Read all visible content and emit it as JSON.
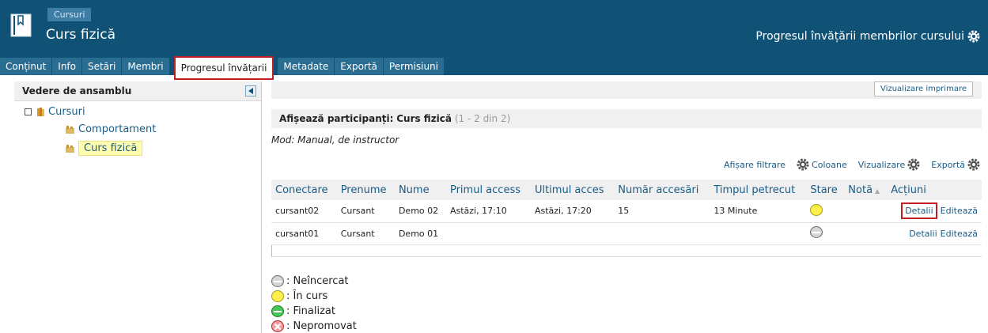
{
  "header": {
    "crumb": "Cursuri",
    "course_title": "Curs fizică",
    "right_title": "Progresul învățării membrilor cursului",
    "icons": {
      "logo": "course-book-icon",
      "settings": "gear-icon"
    }
  },
  "tabs": [
    {
      "label": "Conținut"
    },
    {
      "label": "Info"
    },
    {
      "label": "Setări"
    },
    {
      "label": "Membri"
    },
    {
      "label": "Progresul învățarii"
    },
    {
      "label": "Metadate"
    },
    {
      "label": "Exportă"
    },
    {
      "label": "Permisiuni"
    }
  ],
  "sidebar": {
    "title": "Vedere de ansamblu",
    "tree": {
      "root": "Cursuri",
      "items": [
        "Comportament",
        "Curs fizică"
      ]
    }
  },
  "main": {
    "print_button": "Vizualizare imprimare",
    "participants_label": "Afișează participanți:",
    "participants_course": "Curs fizică",
    "participants_count": "(1 - 2 din 2)",
    "mode": "Mod: Manual, de instructor",
    "toolbar": {
      "filter": "Afișare filtrare",
      "columns": "Coloane",
      "view": "Vizualizare",
      "export": "Exportă"
    },
    "table": {
      "columns": [
        "Conectare",
        "Prenume",
        "Nume",
        "Primul access",
        "Ultimul acces",
        "Număr accesări",
        "Timpul petrecut",
        "Stare",
        "Notă",
        "Acțiuni"
      ],
      "rows": [
        {
          "login": "cursant02",
          "first": "Cursant",
          "last": "Demo 02",
          "first_access": "Astăzi, 17:10",
          "last_access": "Astăzi, 17:20",
          "count": "15",
          "time": "13 Minute",
          "status": "in-progress",
          "grade": "",
          "details": "Detalii",
          "edit": "Editează"
        },
        {
          "login": "cursant01",
          "first": "Cursant",
          "last": "Demo 01",
          "first_access": "",
          "last_access": "",
          "count": "",
          "time": "",
          "status": "not-attempted",
          "grade": "",
          "details": "Detalii",
          "edit": "Editează"
        }
      ]
    },
    "legend": [
      {
        "label": ": Neîncercat",
        "status": "not-attempted"
      },
      {
        "label": ": În curs",
        "status": "in-progress"
      },
      {
        "label": ": Finalizat",
        "status": "completed"
      },
      {
        "label": ": Nepromovat",
        "status": "failed"
      }
    ]
  },
  "colors": {
    "header": "#0f5276",
    "tab": "#2a6d93",
    "highlight": "#c21d25",
    "link": "#1a5c86"
  }
}
